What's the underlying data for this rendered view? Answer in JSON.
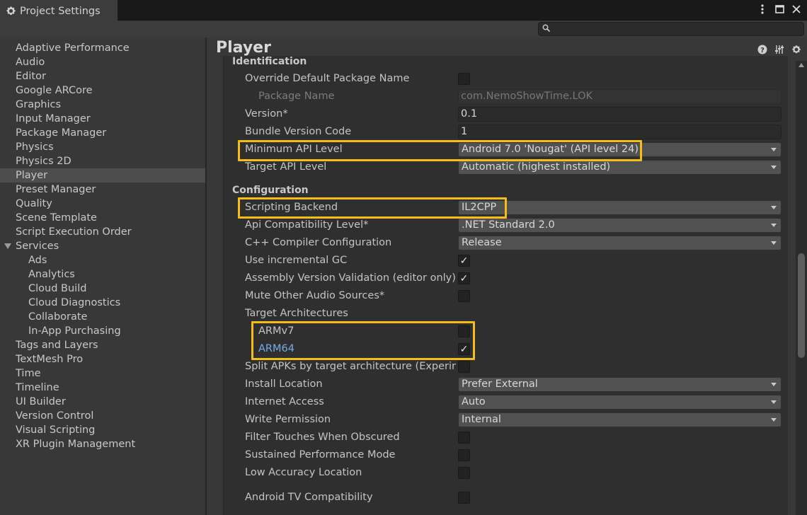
{
  "window": {
    "tab_title": "Project Settings",
    "search": {
      "placeholder": "",
      "value": ""
    }
  },
  "sidebar": {
    "items": [
      {
        "label": "Adaptive Performance"
      },
      {
        "label": "Audio"
      },
      {
        "label": "Editor"
      },
      {
        "label": "Google ARCore"
      },
      {
        "label": "Graphics"
      },
      {
        "label": "Input Manager"
      },
      {
        "label": "Package Manager"
      },
      {
        "label": "Physics"
      },
      {
        "label": "Physics 2D"
      },
      {
        "label": "Player",
        "selected": true
      },
      {
        "label": "Preset Manager"
      },
      {
        "label": "Quality"
      },
      {
        "label": "Scene Template"
      },
      {
        "label": "Script Execution Order"
      },
      {
        "label": "Services",
        "expanded": true
      },
      {
        "label": "Ads",
        "child": true
      },
      {
        "label": "Analytics",
        "child": true
      },
      {
        "label": "Cloud Build",
        "child": true
      },
      {
        "label": "Cloud Diagnostics",
        "child": true
      },
      {
        "label": "Collaborate",
        "child": true
      },
      {
        "label": "In-App Purchasing",
        "child": true
      },
      {
        "label": "Tags and Layers"
      },
      {
        "label": "TextMesh Pro"
      },
      {
        "label": "Time"
      },
      {
        "label": "Timeline"
      },
      {
        "label": "UI Builder"
      },
      {
        "label": "Version Control"
      },
      {
        "label": "Visual Scripting"
      },
      {
        "label": "XR Plugin Management"
      }
    ]
  },
  "main": {
    "title": "Player",
    "sections": {
      "identification": "Identification",
      "configuration": "Configuration"
    },
    "fields": {
      "override_package_name": {
        "label": "Override Default Package Name",
        "checked": false
      },
      "package_name": {
        "label": "Package Name",
        "value": "com.NemoShowTime.LOK"
      },
      "version": {
        "label": "Version*",
        "value": "0.1"
      },
      "bundle_version_code": {
        "label": "Bundle Version Code",
        "value": "1"
      },
      "minimum_api_level": {
        "label": "Minimum API Level",
        "value": "Android 7.0 'Nougat' (API level 24)"
      },
      "target_api_level": {
        "label": "Target API Level",
        "value": "Automatic (highest installed)"
      },
      "scripting_backend": {
        "label": "Scripting Backend",
        "value": "IL2CPP"
      },
      "api_compat_level": {
        "label": "Api Compatibility Level*",
        "value": ".NET Standard 2.0"
      },
      "cpp_compiler_config": {
        "label": "C++ Compiler Configuration",
        "value": "Release"
      },
      "incremental_gc": {
        "label": "Use incremental GC",
        "checked": true
      },
      "assembly_validation": {
        "label": "Assembly Version Validation (editor only)",
        "checked": true
      },
      "mute_other_audio": {
        "label": "Mute Other Audio Sources*",
        "checked": false
      },
      "target_architectures": {
        "label": "Target Architectures"
      },
      "armv7": {
        "label": "ARMv7",
        "checked": false
      },
      "arm64": {
        "label": "ARM64",
        "checked": true
      },
      "split_apks": {
        "label": "Split APKs by target architecture (Experim",
        "checked": false
      },
      "install_location": {
        "label": "Install Location",
        "value": "Prefer External"
      },
      "internet_access": {
        "label": "Internet Access",
        "value": "Auto"
      },
      "write_permission": {
        "label": "Write Permission",
        "value": "Internal"
      },
      "filter_touches": {
        "label": "Filter Touches When Obscured",
        "checked": false
      },
      "sustained_performance": {
        "label": "Sustained Performance Mode",
        "checked": false
      },
      "low_accuracy_location": {
        "label": "Low Accuracy Location",
        "checked": false
      },
      "android_tv": {
        "label": "Android TV Compatibility",
        "checked": false
      }
    },
    "check_mark": "✓"
  },
  "colors": {
    "highlight": "#f5bd18",
    "panel_bg": "#383838",
    "content_bg": "#2f2f2f",
    "link_blue": "#7aa9e8"
  },
  "icons": [
    "gear-icon",
    "kebab-menu-icon",
    "maximize-icon",
    "close-icon",
    "search-icon",
    "help-icon",
    "preset-icon",
    "settings-gear-icon"
  ]
}
